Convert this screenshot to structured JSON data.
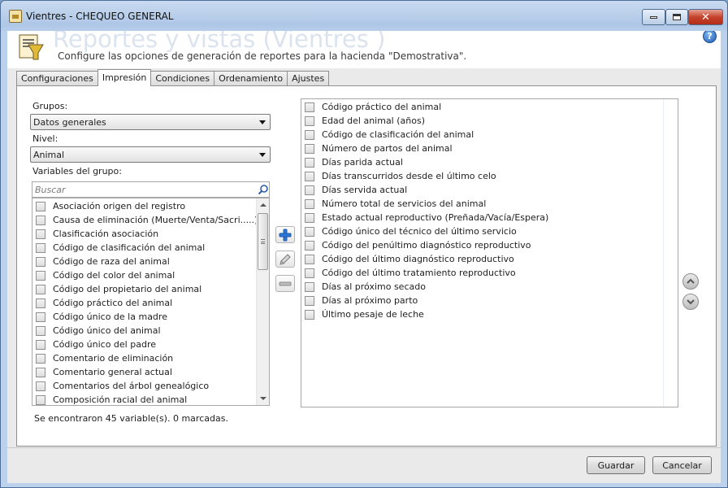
{
  "window": {
    "title": "Vientres  - CHEQUEO GENERAL"
  },
  "header": {
    "title": "Reportes y vistas (Vientres )",
    "subtitle": "Configure las opciones de generación de reportes para la hacienda \"Demostrativa\"."
  },
  "tabs": [
    {
      "label": "Configuraciones",
      "active": false
    },
    {
      "label": "Impresión",
      "active": true
    },
    {
      "label": "Condiciones",
      "active": false
    },
    {
      "label": "Ordenamiento",
      "active": false
    },
    {
      "label": "Ajustes",
      "active": false
    }
  ],
  "form": {
    "grupos_label": "Grupos:",
    "grupos_value": "Datos generales",
    "nivel_label": "Nivel:",
    "nivel_value": "Animal",
    "variables_label": "Variables del grupo:",
    "search_placeholder": "Buscar"
  },
  "available_variables": [
    "Asociación origen del registro",
    "Causa de eliminación (Muerte/Venta/Sacri.....)",
    "Clasificación asociación",
    "Código de clasificación del animal",
    "Código de raza del animal",
    "Código del color del animal",
    "Código del propietario del animal",
    "Código práctico del animal",
    "Código único de la madre",
    "Código único del animal",
    "Código único del padre",
    "Comentario de eliminación",
    "Comentario general actual",
    "Comentarios del árbol genealógico",
    "Composición racial del animal"
  ],
  "selected_variables": [
    "Código práctico del animal",
    "Edad del animal (años)",
    "Código de clasificación del animal",
    "Número de partos del animal",
    "Días parida actual",
    "Días transcurridos desde el último celo",
    "Días servida actual",
    "Número total de servicios del animal",
    "Estado actual reproductivo (Preñada/Vacía/Espera)",
    "Código único del técnico del último servicio",
    "Código del penúltimo diagnóstico reproductivo",
    "Código del último diagnóstico reproductivo",
    "Código del último tratamiento reproductivo",
    "Días al próximo secado",
    "Días al próximo parto",
    "Último pesaje de leche"
  ],
  "status_text": "Se encontraron 45 variable(s). 0 marcadas.",
  "buttons": {
    "save": "Guardar",
    "cancel": "Cancelar"
  },
  "icons": {
    "add": "plus-icon",
    "edit": "pencil-icon",
    "remove": "minus-icon",
    "up": "move-up-icon",
    "down": "move-down-icon",
    "help": "help-icon"
  },
  "colors": {
    "add_icon": "#2b78d8",
    "title_faint": "#dbe4ee",
    "close_button": "#c4432d"
  }
}
